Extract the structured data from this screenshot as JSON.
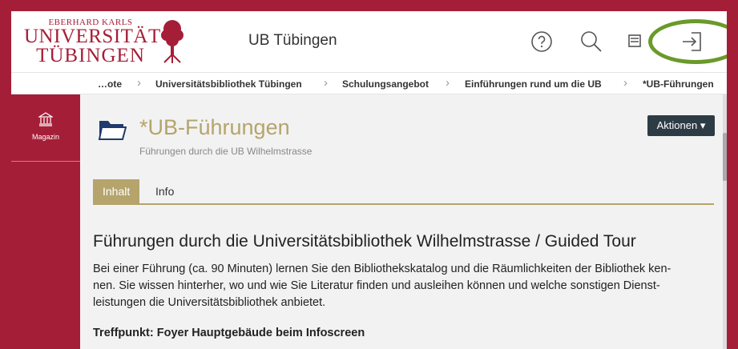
{
  "header": {
    "logo": {
      "line1": "EBERHARD KARLS",
      "line2": "UNIVERSITÄT",
      "line3": "TÜBINGEN"
    },
    "site_title": "UB Tübingen"
  },
  "breadcrumb": [
    {
      "label": "…ote"
    },
    {
      "label": "Universitätsbibliothek Tübingen"
    },
    {
      "label": "Schulungsangebot"
    },
    {
      "label": "Einführungen rund um die UB"
    },
    {
      "label": "*UB-Führungen"
    }
  ],
  "sidebar": {
    "items": [
      {
        "label": "Magazin",
        "icon": "library-icon"
      }
    ]
  },
  "page": {
    "title": "*UB-Führungen",
    "subtitle": "Führungen durch die UB Wilhelmstrasse",
    "actions_label": "Aktionen"
  },
  "tabs": [
    {
      "label": "Inhalt",
      "active": true
    },
    {
      "label": "Info",
      "active": false
    }
  ],
  "content": {
    "heading": "Führungen durch die Universitätsbibliothek Wilhelmstrasse / Guided Tour",
    "paragraph_lines": [
      "Bei einer Führung (ca. 90 Minuten)  lernen Sie den Bibliothekskatalog und die Räumlichkeiten der Bibliothek ken-",
      "nen. Sie wissen hinterher, wo und wie Sie Literatur finden und ausleihen können und welche sonstigen Dienst-",
      "leistungen die Universitätsbibliothek anbietet."
    ],
    "meeting_point": "Treffpunkt: Foyer Hauptgebäude beim Infoscreen"
  },
  "colors": {
    "brand": "#a51e37",
    "accent": "#b5a46b",
    "highlight": "#6a9a2a",
    "button": "#2d3b45"
  }
}
